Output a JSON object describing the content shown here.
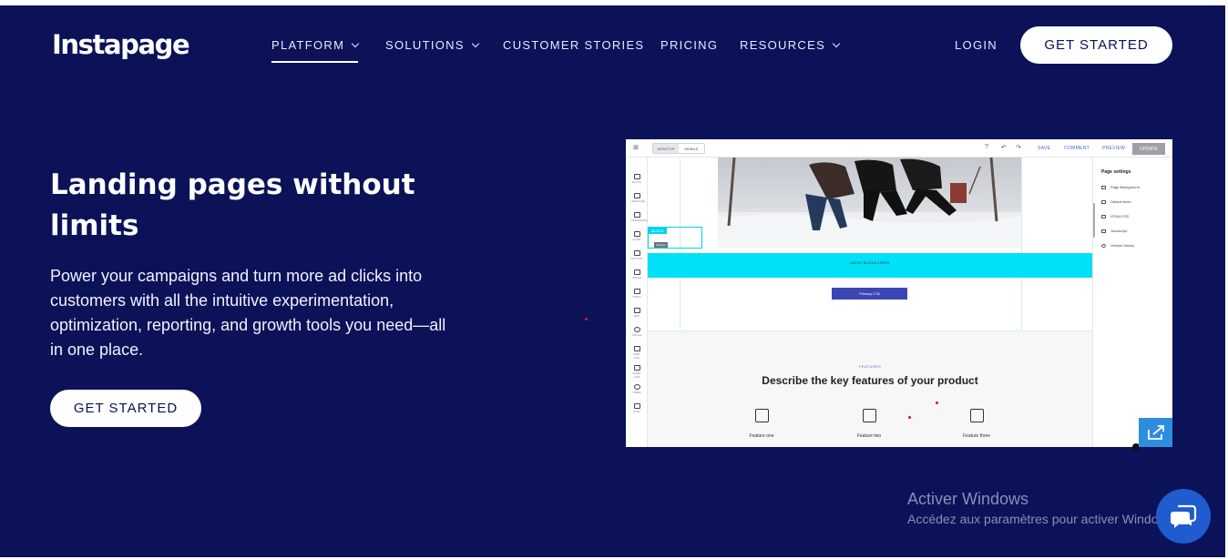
{
  "header": {
    "logo": "Instapage",
    "nav": [
      {
        "label": "PLATFORM",
        "dropdown": true,
        "active": true
      },
      {
        "label": "SOLUTIONS",
        "dropdown": true,
        "active": false
      },
      {
        "label": "CUSTOMER STORIES",
        "dropdown": false,
        "active": false
      },
      {
        "label": "PRICING",
        "dropdown": false,
        "active": false
      },
      {
        "label": "RESOURCES",
        "dropdown": true,
        "active": false
      }
    ],
    "login": "LOGIN",
    "cta": "GET STARTED"
  },
  "hero": {
    "title": "Landing pages without limits",
    "text": "Power your campaigns and turn more ad clicks into customers with all the intuitive experimentation, optimization, reporting, and growth tools you need—all in one place.",
    "cta": "GET STARTED"
  },
  "preview": {
    "toggle": [
      "DESKTOP",
      "MOBILE"
    ],
    "actions": [
      "SAVE",
      "COMMENT",
      "PREVIEW"
    ],
    "update": "UPDATE",
    "tools": [
      "BLOCK",
      "HEADLINE",
      "PARAGRAPH",
      "FORM",
      "BUTTON",
      "IMAGE",
      "VIDEO",
      "BOX",
      "CIRCLE",
      "VERT. LINE",
      "HORZ. LINE",
      "TIMER",
      "HTML"
    ],
    "block_tag": "BLOCK",
    "block_subtag": "Settings",
    "band_label": "MOVE BLOCK HERE",
    "cta": "Primary CTA",
    "features_eyebrow": "FEATURES",
    "features_title": "Describe the key features of your product",
    "features": [
      "Feature one",
      "Feature two",
      "Feature three"
    ],
    "settings_title": "Page settings",
    "settings": [
      "Page Background",
      "Default fonts",
      "HTML/CSS",
      "Javascript",
      "Version history"
    ]
  },
  "watermark": {
    "title": "Activer Windows",
    "subtitle": "Accédez aux paramètres pour activer Windows."
  },
  "colors": {
    "background": "#0b1257",
    "accent_cyan": "#00e0f6",
    "cta_blue": "#3b45b4",
    "chat": "#1e5ccf"
  },
  "icons": {
    "chat": "chat-bubble-icon",
    "expand": "expand-arrow-icon"
  }
}
